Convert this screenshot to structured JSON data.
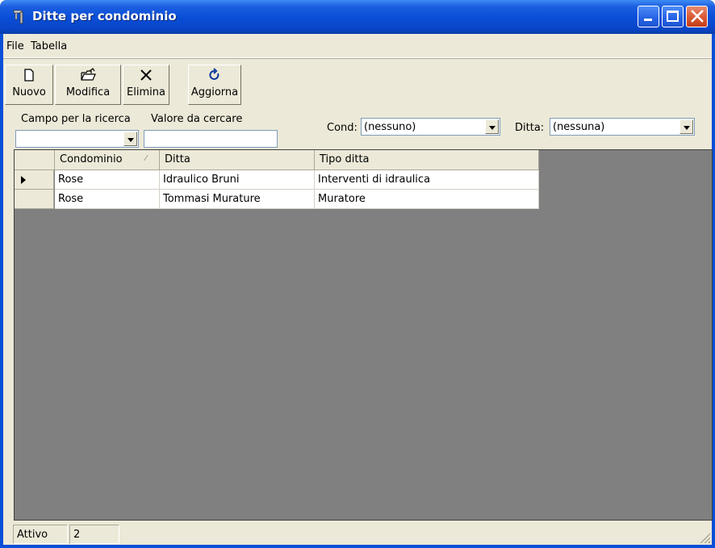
{
  "window": {
    "title": "Ditte per condominio"
  },
  "menu": {
    "items": [
      "File",
      "Tabella"
    ]
  },
  "toolbar": {
    "new_label": "Nuovo",
    "edit_label": "Modifica",
    "delete_label": "Elimina",
    "refresh_label": "Aggiorna"
  },
  "search": {
    "field_label": "Campo per la ricerca",
    "field_value": "",
    "value_label": "Valore da cercare",
    "value_value": ""
  },
  "filters": {
    "cond_label": "Cond:",
    "cond_value": "(nessuno)",
    "ditta_label": "Ditta:",
    "ditta_value": "(nessuna)"
  },
  "grid": {
    "columns": [
      "Condominio",
      "Ditta",
      "Tipo ditta"
    ],
    "sort_indicator": "⁄",
    "rows": [
      [
        "Rose",
        "Idraulico Bruni",
        "Interventi di idraulica"
      ],
      [
        "Rose",
        "Tommasi Murature",
        "Muratore"
      ]
    ]
  },
  "status": {
    "state": "Attivo",
    "count": "2"
  }
}
